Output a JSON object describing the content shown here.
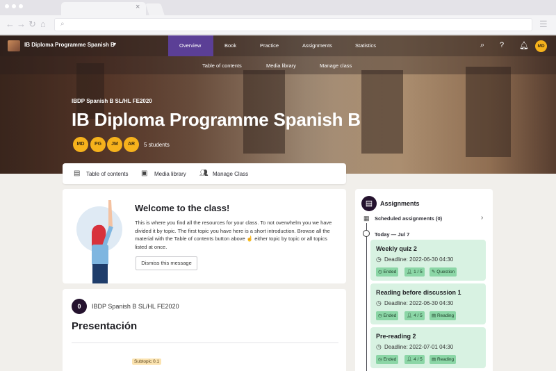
{
  "browser": {
    "url_icon": "search-icon",
    "tab_close": "×"
  },
  "site": {
    "title": "IB Diploma Programme Spanish B",
    "user_initials": "MD"
  },
  "nav": {
    "tabs": [
      "Overview",
      "Book",
      "Practice",
      "Assignments",
      "Statistics"
    ],
    "active_tab": "Overview",
    "subtabs": [
      "Table of contents",
      "Media library",
      "Manage class"
    ]
  },
  "hero": {
    "course_code": "IBDP Spanish B SL/HL FE2020",
    "title": "IB Diploma Programme Spanish B",
    "students": [
      "MD",
      "PG",
      "JM",
      "AR"
    ],
    "student_count": "5 students"
  },
  "linkbar": [
    "Table of contents",
    "Media library",
    "Manage Class"
  ],
  "welcome": {
    "title": "Welcome to the class!",
    "text": "This is where you find all the resources for your class. To not overwhelm you we have divided it by topic. The first topic you have here is a short introduction. Browse all the material with the Table of contents button above ☝ either topic by topic or all topics listed at once.",
    "dismiss": "Dismiss this message"
  },
  "topic": {
    "number": "0",
    "course": "IBDP Spanish B SL/HL FE2020",
    "title": "Presentación",
    "subtopic": "Subtopic 0.1"
  },
  "assignments": {
    "title": "Assignments",
    "scheduled": "Scheduled assignments (0)",
    "today": "Today — Jul 7",
    "items": [
      {
        "title": "Weekly quiz 2",
        "deadline": "Deadline: 2022-06-30 04:30",
        "status": "Ended",
        "count": "1 / 5",
        "type": "Question"
      },
      {
        "title": "Reading before discussion 1",
        "deadline": "Deadline: 2022-06-30 04:30",
        "status": "Ended",
        "count": "4 / 5",
        "type": "Reading"
      },
      {
        "title": "Pre-reading 2",
        "deadline": "Deadline: 2022-07-01 04:30",
        "status": "Ended",
        "count": "4 / 5",
        "type": "Reading"
      }
    ]
  },
  "colors": {
    "accent": "#5b3f96",
    "avatar": "#f6b21c",
    "assignment_card": "#d8f2e2",
    "chip": "#8bd6a6",
    "dark": "#24122e"
  }
}
